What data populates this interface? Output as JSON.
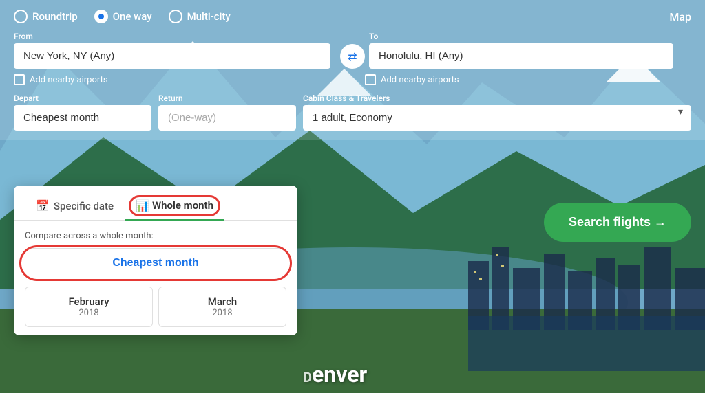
{
  "background": {
    "gradient_description": "mountain lake scenic background"
  },
  "header": {
    "map_label": "Map"
  },
  "trip_type": {
    "options": [
      {
        "id": "roundtrip",
        "label": "Roundtrip",
        "selected": false
      },
      {
        "id": "one-way",
        "label": "One way",
        "selected": true
      },
      {
        "id": "multi-city",
        "label": "Multi-city",
        "selected": false
      }
    ]
  },
  "from_field": {
    "label": "From",
    "value": "New York, NY (Any)",
    "placeholder": "New York, NY (Any)"
  },
  "to_field": {
    "label": "To",
    "value": "Honolulu, HI (Any)",
    "placeholder": "Honolulu, HI (Any)"
  },
  "nearby_airports": {
    "from_label": "Add nearby airports",
    "to_label": "Add nearby airports"
  },
  "depart_field": {
    "label": "Depart",
    "value": "Cheapest month"
  },
  "return_field": {
    "label": "Return",
    "value": "(One-way)"
  },
  "cabin_class": {
    "label": "Cabin Class & Travelers",
    "value": "1 adult, Economy"
  },
  "search_button": {
    "label": "Search flights →"
  },
  "dropdown": {
    "tabs": [
      {
        "id": "specific-date",
        "icon": "📅",
        "label": "Specific date",
        "active": false
      },
      {
        "id": "whole-month",
        "icon": "📊",
        "label": "Whole month",
        "active": true
      }
    ],
    "compare_label": "Compare across a whole month:",
    "cheapest_month_label": "Cheapest month",
    "months": [
      {
        "name": "February",
        "year": "2018"
      },
      {
        "name": "March",
        "year": "2018"
      }
    ]
  },
  "city_name": "enver"
}
